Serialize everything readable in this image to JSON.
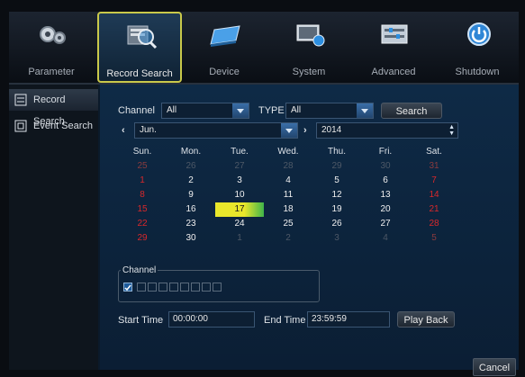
{
  "toolbar": {
    "items": [
      {
        "label": "Parameter",
        "icon": "gears-icon"
      },
      {
        "label": "Record Search",
        "icon": "record-search-icon"
      },
      {
        "label": "Device",
        "icon": "hard-disk-icon"
      },
      {
        "label": "System",
        "icon": "system-monitor-icon"
      },
      {
        "label": "Advanced",
        "icon": "advanced-panel-icon"
      },
      {
        "label": "Shutdown",
        "icon": "power-icon"
      }
    ],
    "active": "Record Search"
  },
  "sidebar": {
    "items": [
      {
        "label": "Record Search",
        "icon": "record-search-icon"
      },
      {
        "label": "Event Search",
        "icon": "event-search-icon"
      }
    ]
  },
  "search": {
    "channel_label": "Channel",
    "channel_value": "All",
    "type_label": "TYPE",
    "type_value": "All",
    "search_button": "Search",
    "month_value": "Jun.",
    "year_value": "2014"
  },
  "calendar": {
    "weekdays": [
      "Sun.",
      "Mon.",
      "Tue.",
      "Wed.",
      "Thu.",
      "Fri.",
      "Sat."
    ],
    "weeks": [
      [
        "25",
        "26",
        "27",
        "28",
        "29",
        "30",
        "31"
      ],
      [
        "1",
        "2",
        "3",
        "4",
        "5",
        "6",
        "7"
      ],
      [
        "8",
        "9",
        "10",
        "11",
        "12",
        "13",
        "14"
      ],
      [
        "15",
        "16",
        "17",
        "18",
        "19",
        "20",
        "21"
      ],
      [
        "22",
        "23",
        "24",
        "25",
        "26",
        "27",
        "28"
      ],
      [
        "29",
        "30",
        "1",
        "2",
        "3",
        "4",
        "5"
      ]
    ],
    "selected_day": "17"
  },
  "channel_group": {
    "legend": "Channel",
    "all_checked": true,
    "channel_count": 8
  },
  "playback": {
    "start_label": "Start Time",
    "start_value": "00:00:00",
    "end_label": "End Time",
    "end_value": "23:59:59",
    "play_button": "Play Back"
  },
  "footer": {
    "cancel_button": "Cancel"
  }
}
